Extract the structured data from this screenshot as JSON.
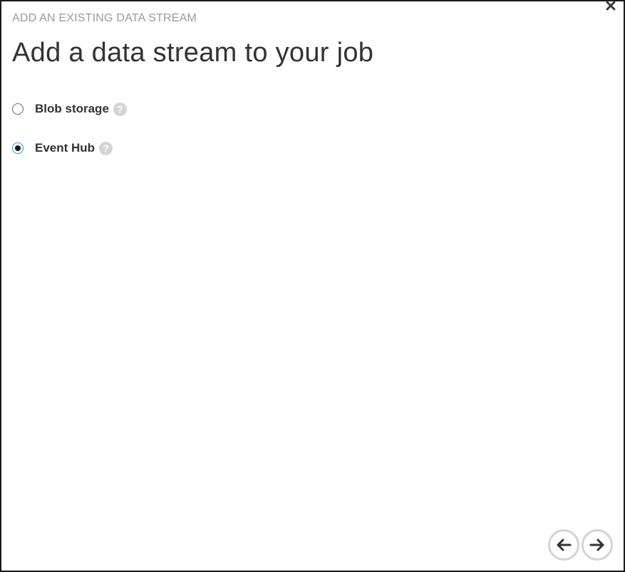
{
  "dialog": {
    "subtitle": "ADD AN EXISTING DATA STREAM",
    "title": "Add a data stream to your job",
    "close_icon": "close-icon"
  },
  "options": [
    {
      "label": "Blob storage",
      "selected": false,
      "help_icon": "question-icon"
    },
    {
      "label": "Event Hub",
      "selected": true,
      "help_icon": "question-icon"
    }
  ],
  "help": {
    "glyph": "?"
  },
  "navigation": {
    "back_icon": "arrow-left-icon",
    "next_icon": "arrow-right-icon"
  },
  "colors": {
    "title": "#333333",
    "subtitle": "#9a9a9a",
    "radio_selected_ring": "#2a9bd6",
    "help_icon_bg": "#d4d4d4",
    "nav_ring": "#d4d4d4"
  }
}
